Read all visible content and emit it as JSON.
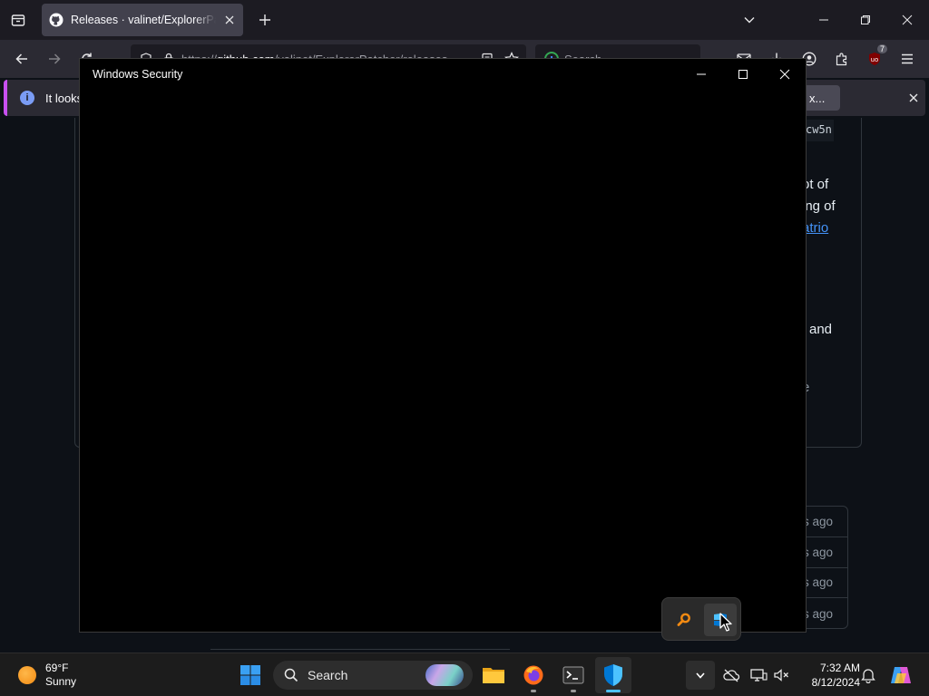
{
  "browser": {
    "tab_title": "Releases · valinet/ExplorerPatcher",
    "url_prefix": "https://",
    "url_host": "github.com",
    "url_path": "/valinet/ExplorerPatcher/releases",
    "search_placeholder": "Search",
    "ublock_count": "7"
  },
  "notification": {
    "text": "It looks l",
    "action_label": "x..."
  },
  "page_behind": {
    "code_fragment": "cw5n",
    "line1": "ot of",
    "line2": "ing of",
    "link": "atrio",
    "line3": "and",
    "line4": "e",
    "asset_times": [
      "s ago",
      "s ago",
      "s ago",
      "s ago"
    ]
  },
  "security_window": {
    "title": "Windows Security"
  },
  "taskbar": {
    "weather_temp": "69°F",
    "weather_desc": "Sunny",
    "search_label": "Search",
    "time": "7:32 AM",
    "date": "8/12/2024"
  },
  "colors": {
    "accent_blue": "#4cc2ff",
    "defender_blue": "#0078d4",
    "notification_border": "#c850f0"
  }
}
